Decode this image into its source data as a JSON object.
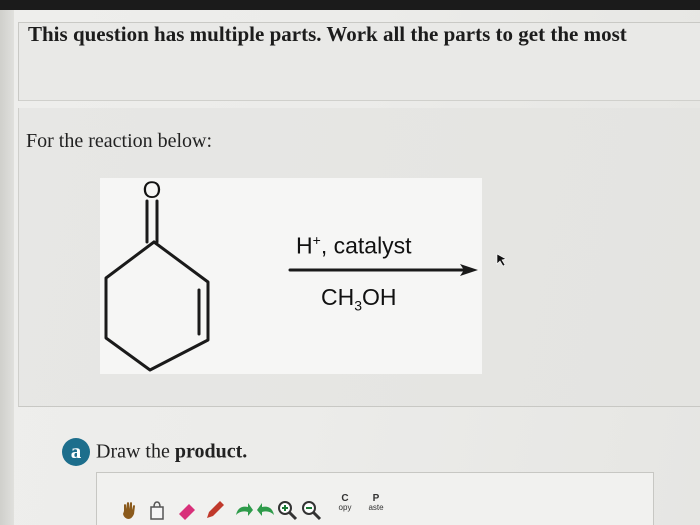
{
  "header": {
    "text": "This question has multiple parts. Work all the parts to get the most"
  },
  "prompt": {
    "text": "For the reaction below:"
  },
  "reaction": {
    "reagent_top": "H",
    "reagent_top_sup": "+",
    "reagent_top_rest": ", catalyst",
    "reagent_bottom_a": "CH",
    "reagent_bottom_sub": "3",
    "reagent_bottom_b": "OH",
    "carbonyl_atom": "O"
  },
  "part_a": {
    "badge": "a",
    "label": "Draw the",
    "strong": "product."
  },
  "toolbar": {
    "tools": [
      {
        "icon": "hand-icon"
      },
      {
        "icon": "lasso-icon"
      },
      {
        "icon": "eraser-icon"
      },
      {
        "icon": "pencil-icon"
      },
      {
        "icon": "undo-icon"
      },
      {
        "icon": "redo-icon"
      },
      {
        "icon": "zoom-in-icon"
      },
      {
        "icon": "zoom-out-icon"
      }
    ],
    "copy_letter": "C",
    "copy_rest": "opy",
    "paste_letter": "P",
    "paste_rest": "aste"
  },
  "colors": {
    "badge": "#1d6e8c",
    "text": "#222222"
  }
}
